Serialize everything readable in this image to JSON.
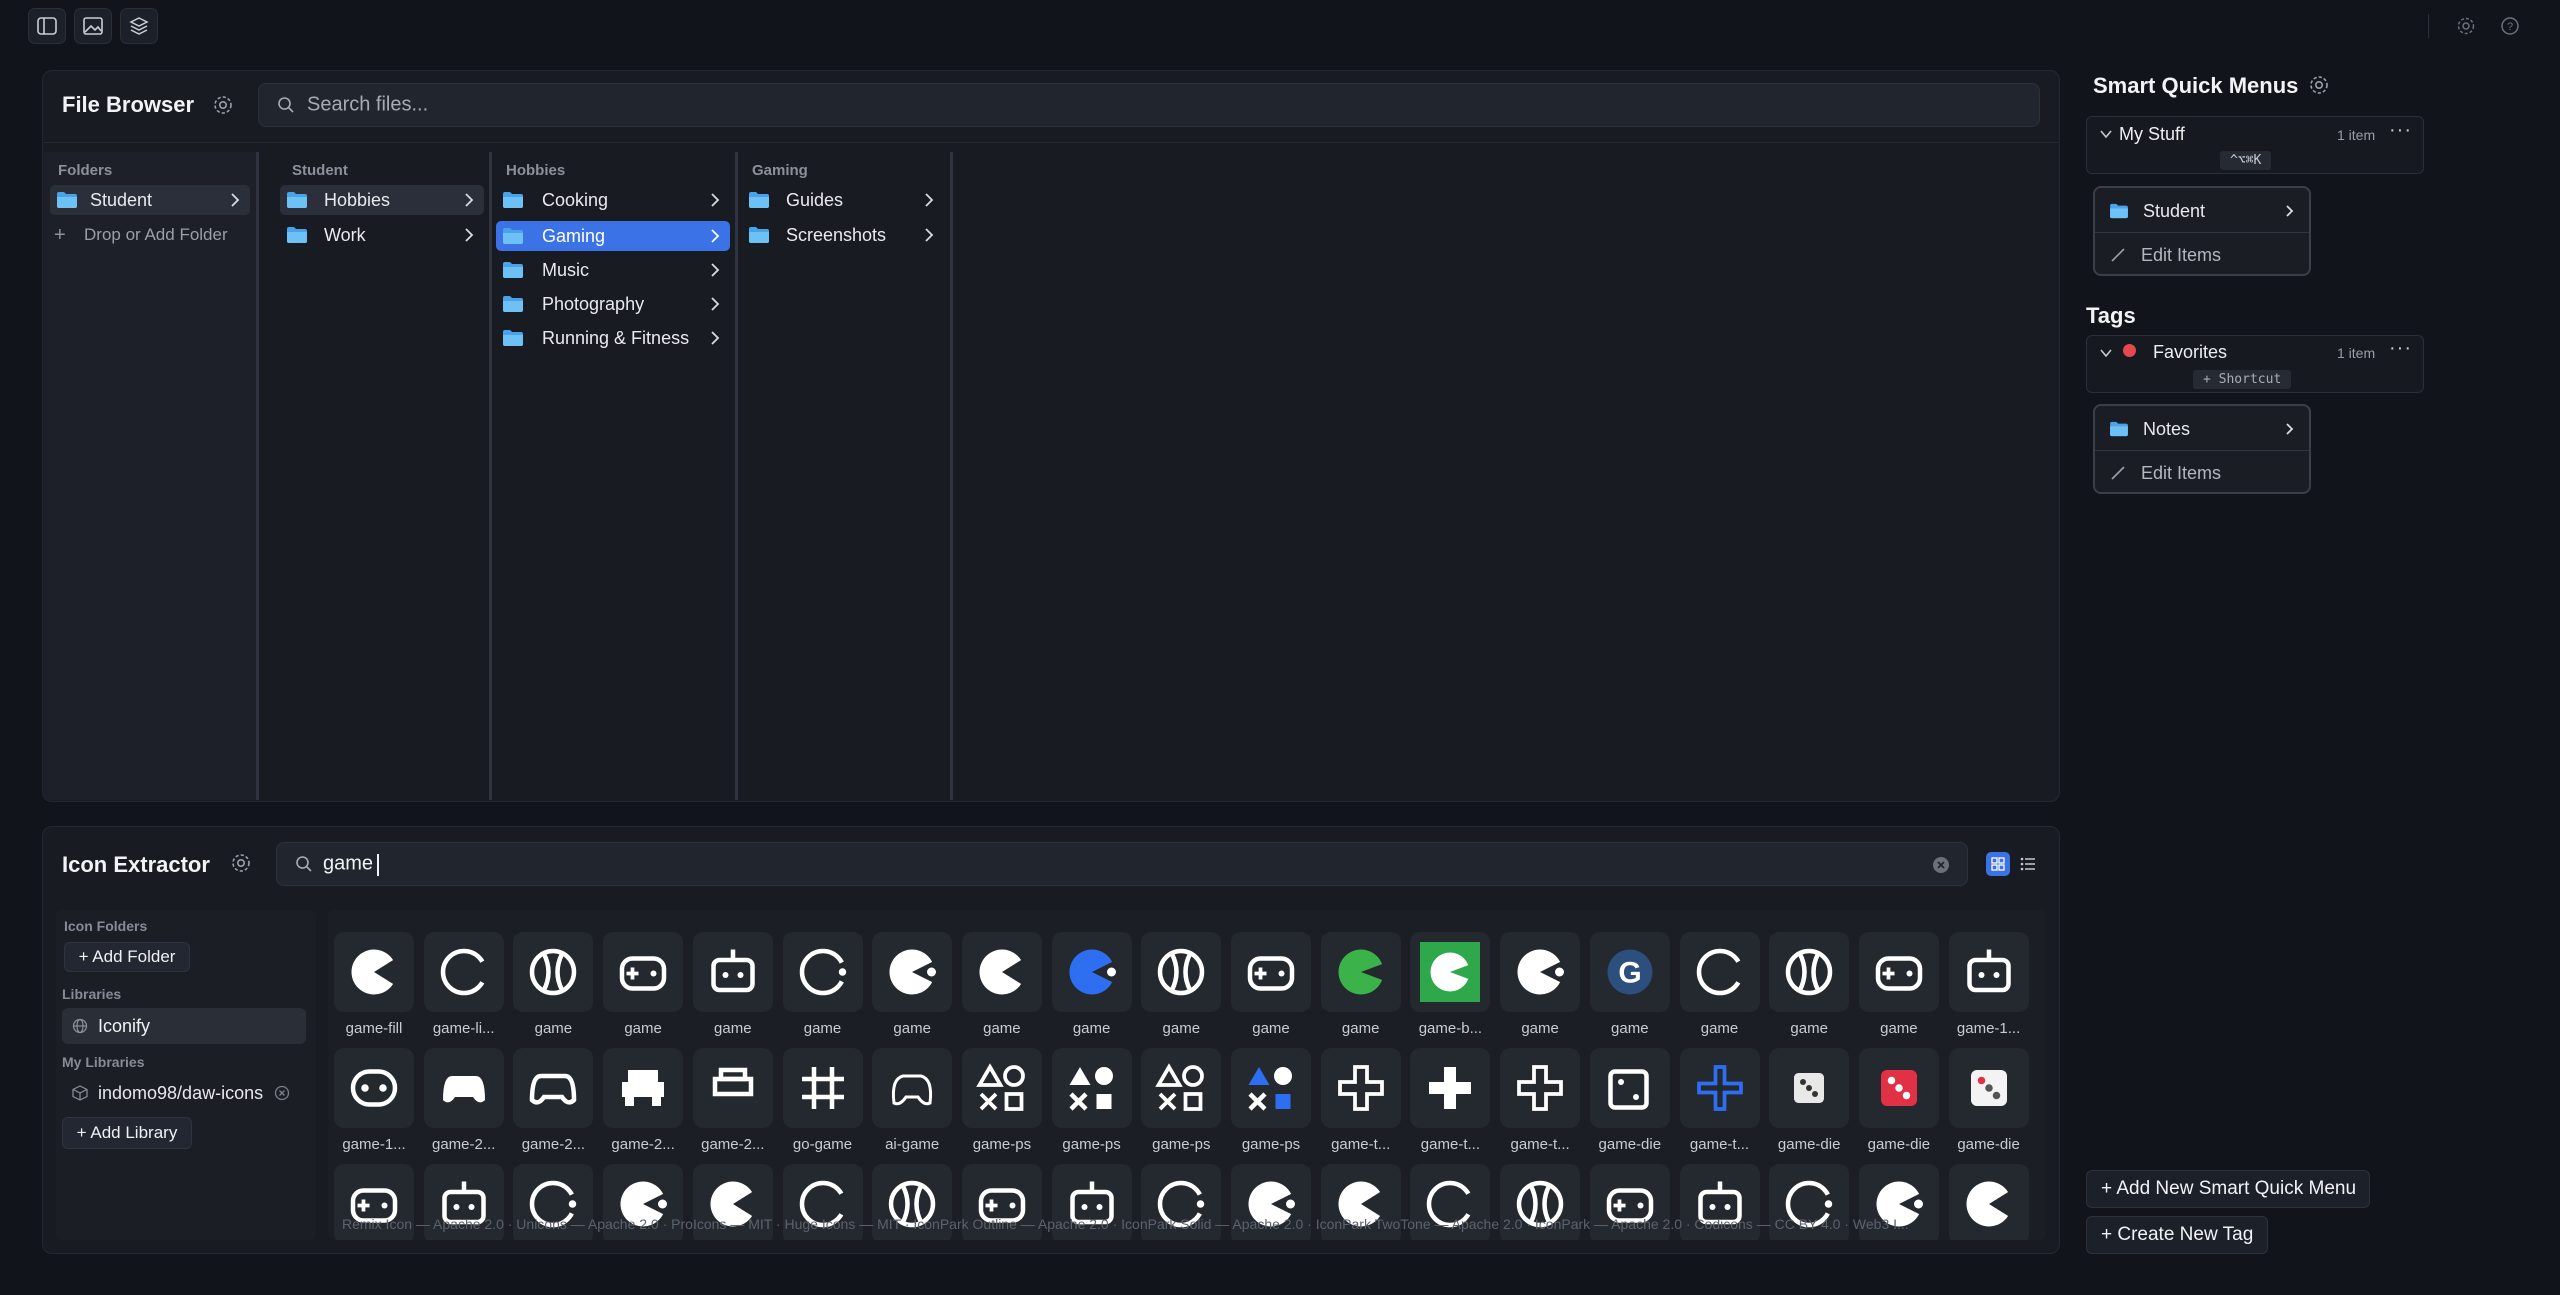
{
  "toolbar": {
    "left_icons": [
      "sidebar-toggle-icon",
      "image-icon",
      "layers-icon"
    ],
    "right_icons": [
      "settings-icon",
      "help-icon"
    ]
  },
  "file_browser": {
    "title": "File Browser",
    "search_placeholder": "Search files...",
    "columns": [
      {
        "header": "Folders",
        "items": [
          {
            "label": "Student",
            "state": "selected"
          }
        ],
        "add_label": "Drop or Add Folder"
      },
      {
        "header": "Student",
        "items": [
          {
            "label": "Hobbies",
            "state": "selected"
          },
          {
            "label": "Work",
            "state": ""
          }
        ]
      },
      {
        "header": "Hobbies",
        "items": [
          {
            "label": "Cooking",
            "state": ""
          },
          {
            "label": "Gaming",
            "state": "active"
          },
          {
            "label": "Music",
            "state": ""
          },
          {
            "label": "Photography",
            "state": ""
          },
          {
            "label": "Running & Fitness",
            "state": ""
          }
        ]
      },
      {
        "header": "Gaming",
        "items": [
          {
            "label": "Guides",
            "state": ""
          },
          {
            "label": "Screenshots",
            "state": ""
          }
        ]
      }
    ]
  },
  "smart_quick_menus": {
    "title": "Smart Quick Menus",
    "menu": {
      "name": "My Stuff",
      "count": "1 item",
      "shortcut": "^⌥⌘K"
    },
    "popover": {
      "item": "Student",
      "edit": "Edit Items"
    },
    "add_button": "+ Add New Smart Quick Menu"
  },
  "tags": {
    "title": "Tags",
    "tag": {
      "name": "Favorites",
      "count": "1 item",
      "shortcut": "+ Shortcut",
      "color": "#e5484d"
    },
    "popover": {
      "item": "Notes",
      "edit": "Edit Items"
    },
    "add_button": "+ Create New Tag"
  },
  "icon_extractor": {
    "title": "Icon Extractor",
    "search_value": "game",
    "sidebar": {
      "icon_folders_head": "Icon Folders",
      "add_folder": "+ Add Folder",
      "libraries_head": "Libraries",
      "library": "Iconify",
      "my_libraries_head": "My Libraries",
      "my_library": "indomo98/daw-icons",
      "add_library": "+ Add Library"
    },
    "row1": [
      "game-fill",
      "game-li...",
      "game",
      "game",
      "game",
      "game",
      "game",
      "game",
      "game",
      "game",
      "game",
      "game",
      "game-b...",
      "game",
      "game",
      "game",
      "game",
      "game",
      "game-1..."
    ],
    "row2": [
      "game-1...",
      "game-2...",
      "game-2...",
      "game-2...",
      "game-2...",
      "go-game",
      "ai-game",
      "game-ps",
      "game-ps",
      "game-ps",
      "game-ps",
      "game-t...",
      "game-t...",
      "game-t...",
      "game-die",
      "game-t...",
      "game-die",
      "game-die",
      "game-die"
    ],
    "credits": "Remix Icon — Apache 2.0 · Unicons — Apache 2.0 · ProIcons — MIT · Huge Icons — MIT · IconPark Outline — Apache 2.0 · IconPark Solid — Apache 2.0 · IconPark TwoTone — Apache 2.0 · IconPark — Apache 2.0 · Codicons — CC BY 4.0 · Web3 I..."
  }
}
